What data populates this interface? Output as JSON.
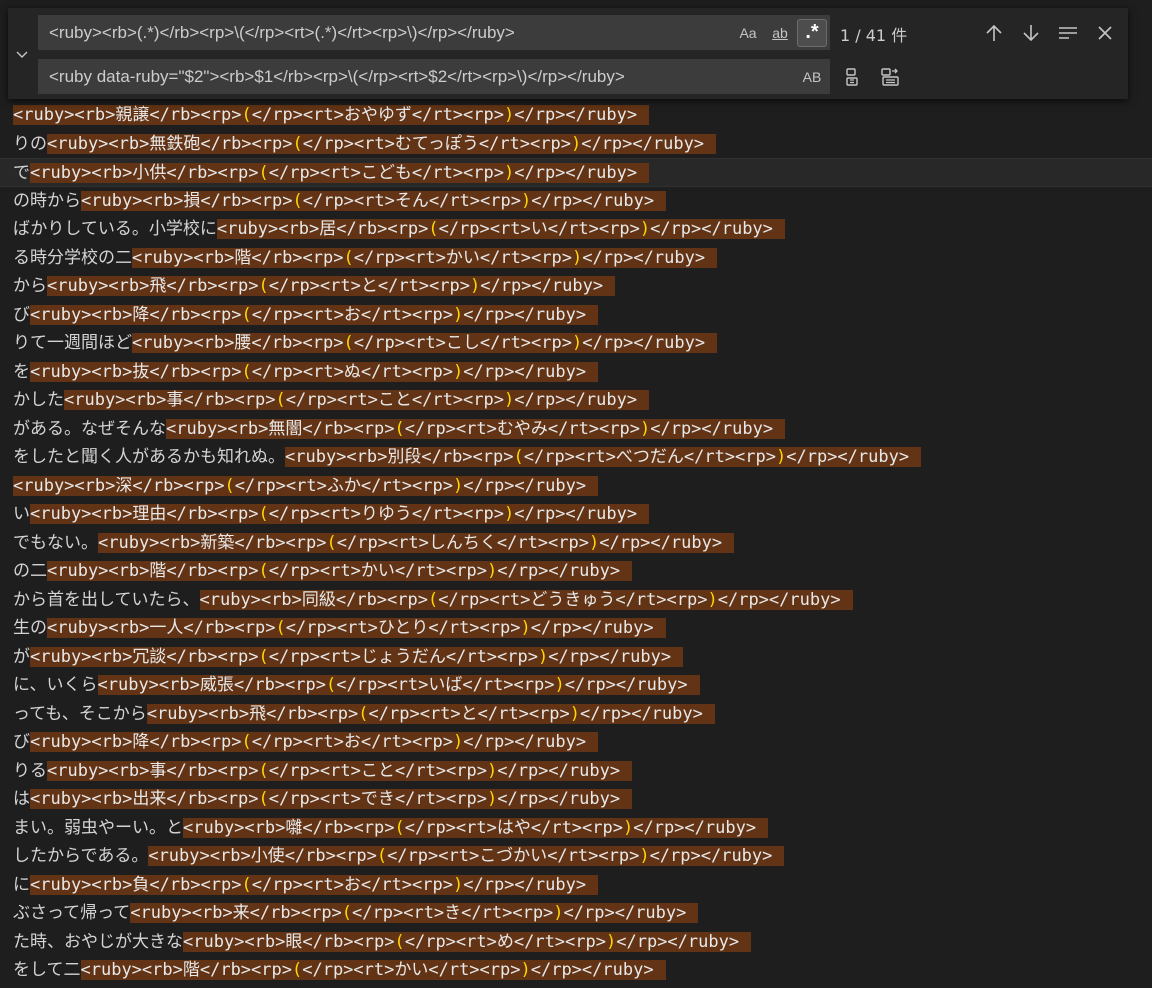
{
  "find": {
    "query": "<ruby><rb>(.*)</rb><rp>\\(</rp><rt>(.*)</rt><rp>\\)</rp></ruby>",
    "match_case_label": "Aa",
    "whole_word_label": "ab",
    "regex_label": ".*",
    "match_count": "1 / 41 件"
  },
  "replace": {
    "value": "<ruby data-ruby=\"$2\"><rb>$1</rb><rp>\\(</rp><rt>$2</rt><rp>\\)</rp></ruby>",
    "preserve_case_label": "AB"
  },
  "icons": {
    "toggle": "chevron-down-icon",
    "prev": "arrow-up-icon",
    "next": "arrow-down-icon",
    "selection": "find-in-selection-icon",
    "close": "close-icon",
    "replace_one": "replace-icon",
    "replace_all": "replace-all-icon"
  },
  "colors": {
    "editor_bg": "#1e1e1e",
    "match_bg": "#623315",
    "paren": "#ffd700",
    "text": "#d4d4d4"
  },
  "lines": [
    {
      "pre": "",
      "rb": "親譲",
      "rt": "おやゆず"
    },
    {
      "pre": "りの",
      "rb": "無鉄砲",
      "rt": "むてっぽう"
    },
    {
      "pre": "で",
      "rb": "小供",
      "rt": "こども",
      "current": true
    },
    {
      "pre": "の時から",
      "rb": "損",
      "rt": "そん"
    },
    {
      "pre": "ばかりしている。小学校に",
      "rb": "居",
      "rt": "い"
    },
    {
      "pre": "る時分学校の二",
      "rb": "階",
      "rt": "かい"
    },
    {
      "pre": "から",
      "rb": "飛",
      "rt": "と"
    },
    {
      "pre": "び",
      "rb": "降",
      "rt": "お"
    },
    {
      "pre": "りて一週間ほど",
      "rb": "腰",
      "rt": "こし"
    },
    {
      "pre": "を",
      "rb": "抜",
      "rt": "ぬ"
    },
    {
      "pre": "かした",
      "rb": "事",
      "rt": "こと"
    },
    {
      "pre": "がある。なぜそんな",
      "rb": "無闇",
      "rt": "むやみ"
    },
    {
      "pre": "をしたと聞く人があるかも知れぬ。",
      "rb": "別段",
      "rt": "べつだん"
    },
    {
      "pre": "",
      "rb": "深",
      "rt": "ふか"
    },
    {
      "pre": "い",
      "rb": "理由",
      "rt": "りゆう"
    },
    {
      "pre": "でもない。",
      "rb": "新築",
      "rt": "しんちく"
    },
    {
      "pre": "の二",
      "rb": "階",
      "rt": "かい"
    },
    {
      "pre": "から首を出していたら、",
      "rb": "同級",
      "rt": "どうきゅう"
    },
    {
      "pre": "生の",
      "rb": "一人",
      "rt": "ひとり"
    },
    {
      "pre": "が",
      "rb": "冗談",
      "rt": "じょうだん"
    },
    {
      "pre": "に、いくら",
      "rb": "威張",
      "rt": "いば"
    },
    {
      "pre": "っても、そこから",
      "rb": "飛",
      "rt": "と"
    },
    {
      "pre": "び",
      "rb": "降",
      "rt": "お"
    },
    {
      "pre": "りる",
      "rb": "事",
      "rt": "こと"
    },
    {
      "pre": "は",
      "rb": "出来",
      "rt": "でき"
    },
    {
      "pre": "まい。弱虫やーい。と",
      "rb": "囃",
      "rt": "はや"
    },
    {
      "pre": "したからである。",
      "rb": "小使",
      "rt": "こづかい"
    },
    {
      "pre": "に",
      "rb": "負",
      "rt": "お"
    },
    {
      "pre": "ぶさって帰って",
      "rb": "来",
      "rt": "き"
    },
    {
      "pre": "た時、おやじが大きな",
      "rb": "眼",
      "rt": "め"
    },
    {
      "pre": "をして二",
      "rb": "階",
      "rt": "かい"
    }
  ]
}
